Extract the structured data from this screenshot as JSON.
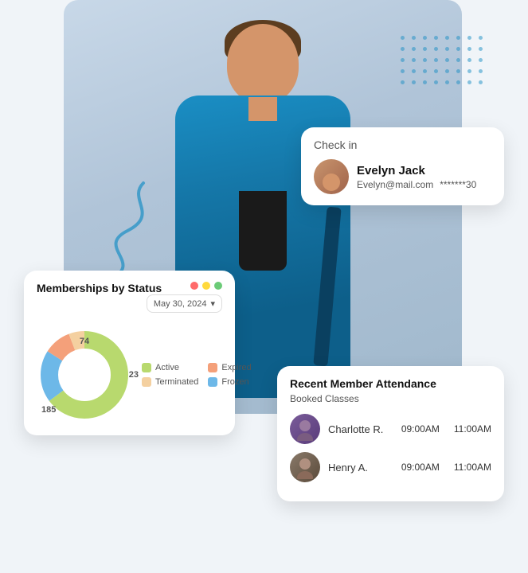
{
  "hero": {
    "bg_color": "#c8d8e8"
  },
  "dot_grid": {
    "dots_count": 40
  },
  "checkin_card": {
    "title": "Check in",
    "user": {
      "name": "Evelyn Jack",
      "email": "Evelyn@mail.com",
      "code": "*******30"
    }
  },
  "membership_card": {
    "title": "Memberships by Status",
    "date_label": "May 30, 2024",
    "chevron": "▾",
    "status_dots": [
      "#ff6b6b",
      "#ffd93d",
      "#6bcb77"
    ],
    "chart": {
      "segments": [
        {
          "label": "Active",
          "value": 185,
          "color": "#b8d96e",
          "percentage": 65
        },
        {
          "label": "Frozen",
          "value": 74,
          "color": "#6db8e8",
          "percentage": 19
        },
        {
          "label": "Expired",
          "value": 23,
          "color": "#f4a07a",
          "percentage": 10
        },
        {
          "label": "Terminated",
          "value": 0,
          "color": "#f4d0a0",
          "percentage": 6
        }
      ],
      "label_74": "74",
      "label_23": "23",
      "label_185": "185"
    },
    "legend": [
      {
        "label": "Active",
        "color": "#b8d96e"
      },
      {
        "label": "Expired",
        "color": "#f4a07a"
      },
      {
        "label": "Terminated",
        "color": "#f4d0a0"
      },
      {
        "label": "Frozen",
        "color": "#6db8e8"
      }
    ]
  },
  "attendance_card": {
    "title": "Recent Member Attendance",
    "subtitle": "Booked Classes",
    "members": [
      {
        "name": "Charlotte R.",
        "time1": "09:00AM",
        "time2": "11:00AM"
      },
      {
        "name": "Henry A.",
        "time1": "09:00AM",
        "time2": "11:00AM"
      }
    ]
  }
}
